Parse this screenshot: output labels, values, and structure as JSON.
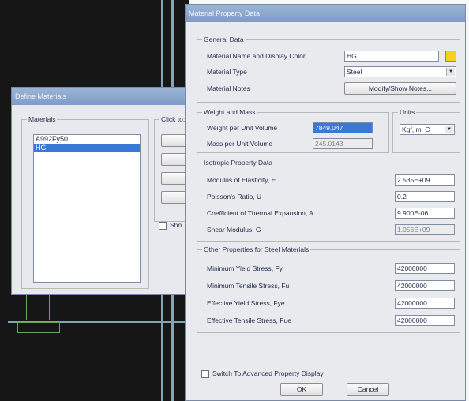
{
  "background": {
    "gridColor": "#7ea6b8",
    "elementColor": "#6da05a"
  },
  "defineMaterials": {
    "title": "Define Materials",
    "materialsGroupTitle": "Materials",
    "materials": [
      "A992Fy50",
      "HG"
    ],
    "selectedIndex": 1,
    "clickToTitle": "Click to:",
    "showCheckboxLabel": "Sho"
  },
  "materialProperty": {
    "title": "Material Property Data",
    "generalData": {
      "title": "General Data",
      "nameLabel": "Material Name and Display Color",
      "nameValue": "HG",
      "displayColor": "#f7d21c",
      "typeLabel": "Material Type",
      "typeValue": "Steel",
      "notesLabel": "Material Notes",
      "notesButton": "Modify/Show Notes..."
    },
    "weightAndMass": {
      "title": "Weight and Mass",
      "weightLabel": "Weight per Unit Volume",
      "weightValue": "7849.047",
      "massLabel": "Mass per Unit Volume",
      "massValue": "245.0143"
    },
    "units": {
      "title": "Units",
      "value": "Kgf, m, C"
    },
    "isotropic": {
      "title": "Isotropic Property Data",
      "rows": [
        {
          "label": "Modulus of Elasticity,  E",
          "value": "2.535E+09"
        },
        {
          "label": "Poisson's Ratio,  U",
          "value": "0.2"
        },
        {
          "label": "Coefficient of Thermal Expansion,  A",
          "value": "9.900E-06"
        },
        {
          "label": "Shear Modulus,  G",
          "value": "1.056E+09"
        }
      ]
    },
    "steel": {
      "title": "Other Properties for Steel Materials",
      "rows": [
        {
          "label": "Minimum Yield Stress, Fy",
          "value": "42000000"
        },
        {
          "label": "Minimum Tensile Stress, Fu",
          "value": "42000000"
        },
        {
          "label": "Effective Yield Stress, Fye",
          "value": "42000000"
        },
        {
          "label": "Effective Tensile Stress, Fue",
          "value": "42000000"
        }
      ]
    },
    "advancedLabel": "Switch To Advanced Property Display",
    "okLabel": "OK",
    "cancelLabel": "Cancel"
  }
}
